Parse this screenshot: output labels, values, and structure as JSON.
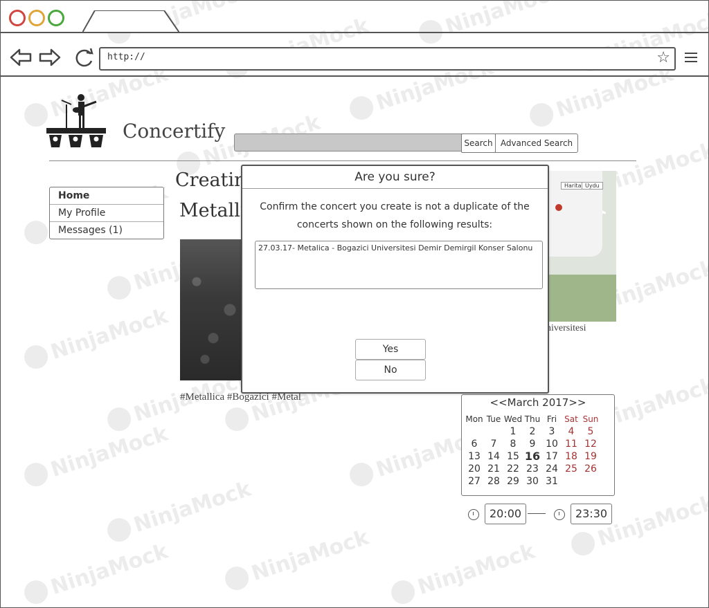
{
  "browser": {
    "url": "http://"
  },
  "header": {
    "app_title": "Concertify",
    "search_button": "Search",
    "advanced_search_button": "Advanced Search"
  },
  "sidebar": {
    "items": [
      {
        "label": "Home"
      },
      {
        "label": "My Profile"
      },
      {
        "label": "Messages (1)"
      }
    ]
  },
  "main": {
    "heading_line1": "Creatin",
    "heading_line2": "Metallic",
    "hashtags": "#Metallica #Bogazici #Metal",
    "map_caption": "niversitesi",
    "map_buttons": [
      "Harita",
      "Uydu"
    ]
  },
  "calendar": {
    "title": "<<March 2017>>",
    "weekdays": [
      "Mon",
      "Tue",
      "Wed",
      "Thu",
      "Fri",
      "Sat",
      "Sun"
    ],
    "weeks": [
      [
        "",
        "",
        "1",
        "2",
        "3",
        "4",
        "5"
      ],
      [
        "6",
        "7",
        "8",
        "9",
        "10",
        "11",
        "12"
      ],
      [
        "13",
        "14",
        "15",
        "16",
        "17",
        "18",
        "19"
      ],
      [
        "20",
        "21",
        "22",
        "23",
        "24",
        "25",
        "26"
      ],
      [
        "27",
        "28",
        "29",
        "30",
        "31",
        "",
        ""
      ]
    ],
    "today": "16",
    "weekend_color": "#a33333"
  },
  "time": {
    "start": "20:00",
    "end": "23:30"
  },
  "modal": {
    "title": "Are you sure?",
    "body": "Confirm the concert you create is not a duplicate of the concerts shown on the following results:",
    "result": "27.03.17- Metalica - Bogazici Universitesi Demir Demirgil Konser Salonu",
    "yes_label": "Yes",
    "no_label": "No"
  }
}
